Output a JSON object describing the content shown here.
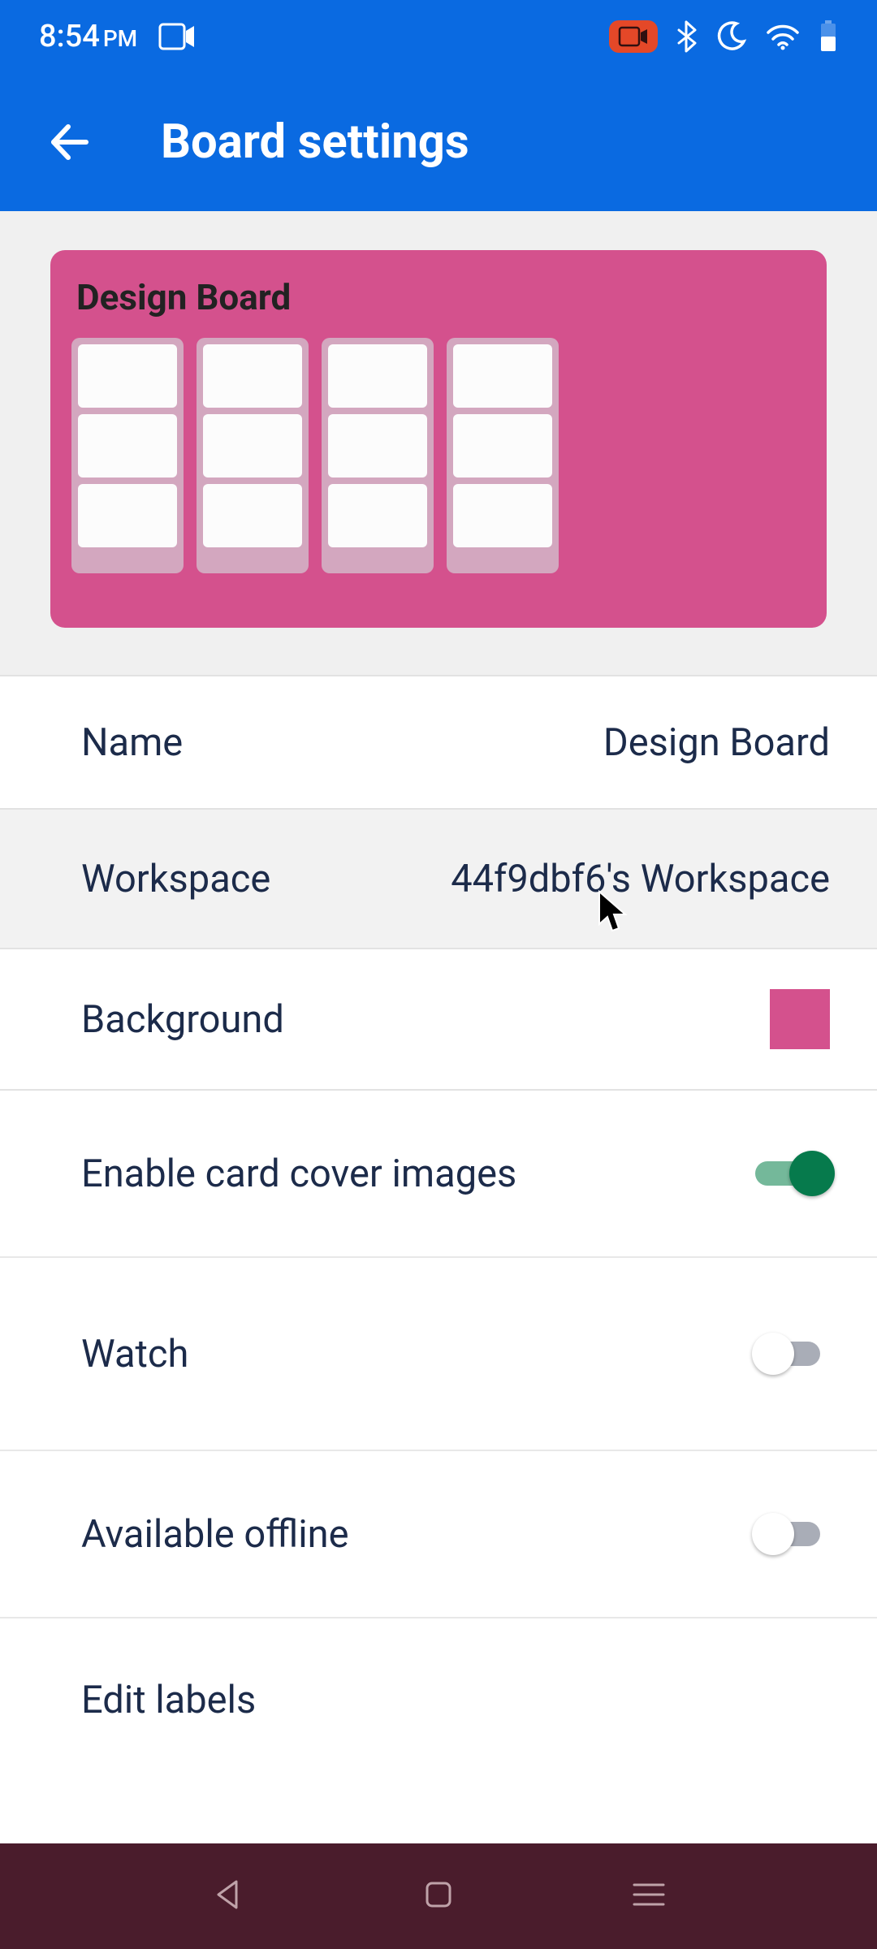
{
  "status": {
    "time": "8:54",
    "ampm": "PM"
  },
  "appbar": {
    "title": "Board settings"
  },
  "preview": {
    "board_title": "Design Board"
  },
  "rows": {
    "name_label": "Name",
    "name_value": "Design Board",
    "workspace_label": "Workspace",
    "workspace_value": "44f9dbf6's Workspace",
    "background_label": "Background",
    "background_color": "#d4518d",
    "cover_label": "Enable card cover images",
    "cover_on": true,
    "watch_label": "Watch",
    "watch_on": false,
    "offline_label": "Available offline",
    "offline_on": false,
    "edit_labels_label": "Edit labels"
  }
}
